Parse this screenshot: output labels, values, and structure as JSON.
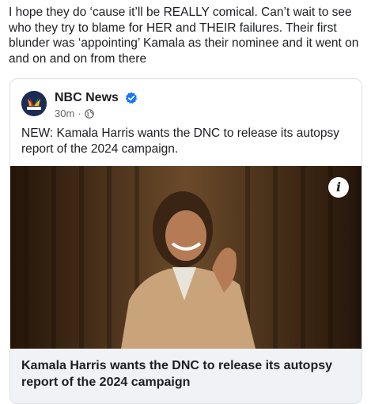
{
  "post": {
    "text": "I hope they do ‘cause it’ll be REALLY comical. Can’t wait to see who they try to blame for HER and THEIR failures. Their first blunder was ‘appointing’ Kamala as their nominee and it went on and on and on from there"
  },
  "shared_post": {
    "source_name": "NBC News",
    "time": "30m",
    "separator": "·",
    "text": "NEW: Kamala Harris wants the DNC to release its autopsy report of the 2024 campaign.",
    "verified_icon": "verified-badge-icon",
    "privacy_icon": "globe-icon",
    "logo_icon": "nbc-peacock-logo",
    "accent_color": "#1877f2",
    "image": {
      "description_icon": "info-icon",
      "info_glyph": "i"
    },
    "link_caption": "Kamala Harris wants the DNC to release its autopsy report of the 2024 campaign"
  }
}
